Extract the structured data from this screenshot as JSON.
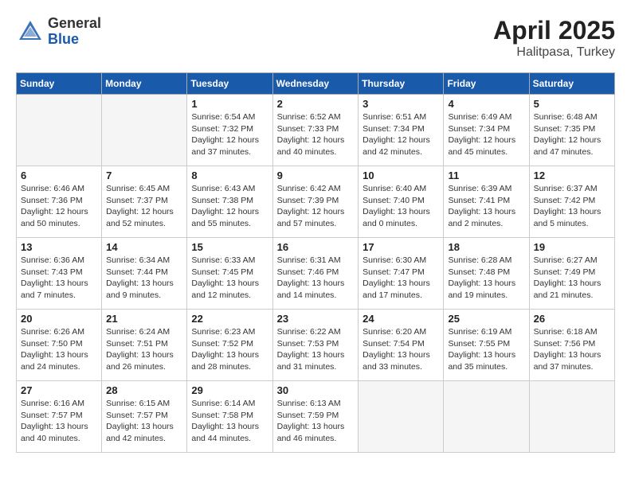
{
  "header": {
    "logo_general": "General",
    "logo_blue": "Blue",
    "month_year": "April 2025",
    "location": "Halitpasa, Turkey"
  },
  "weekdays": [
    "Sunday",
    "Monday",
    "Tuesday",
    "Wednesday",
    "Thursday",
    "Friday",
    "Saturday"
  ],
  "weeks": [
    [
      {
        "day": "",
        "info": ""
      },
      {
        "day": "",
        "info": ""
      },
      {
        "day": "1",
        "info": "Sunrise: 6:54 AM\nSunset: 7:32 PM\nDaylight: 12 hours and 37 minutes."
      },
      {
        "day": "2",
        "info": "Sunrise: 6:52 AM\nSunset: 7:33 PM\nDaylight: 12 hours and 40 minutes."
      },
      {
        "day": "3",
        "info": "Sunrise: 6:51 AM\nSunset: 7:34 PM\nDaylight: 12 hours and 42 minutes."
      },
      {
        "day": "4",
        "info": "Sunrise: 6:49 AM\nSunset: 7:34 PM\nDaylight: 12 hours and 45 minutes."
      },
      {
        "day": "5",
        "info": "Sunrise: 6:48 AM\nSunset: 7:35 PM\nDaylight: 12 hours and 47 minutes."
      }
    ],
    [
      {
        "day": "6",
        "info": "Sunrise: 6:46 AM\nSunset: 7:36 PM\nDaylight: 12 hours and 50 minutes."
      },
      {
        "day": "7",
        "info": "Sunrise: 6:45 AM\nSunset: 7:37 PM\nDaylight: 12 hours and 52 minutes."
      },
      {
        "day": "8",
        "info": "Sunrise: 6:43 AM\nSunset: 7:38 PM\nDaylight: 12 hours and 55 minutes."
      },
      {
        "day": "9",
        "info": "Sunrise: 6:42 AM\nSunset: 7:39 PM\nDaylight: 12 hours and 57 minutes."
      },
      {
        "day": "10",
        "info": "Sunrise: 6:40 AM\nSunset: 7:40 PM\nDaylight: 13 hours and 0 minutes."
      },
      {
        "day": "11",
        "info": "Sunrise: 6:39 AM\nSunset: 7:41 PM\nDaylight: 13 hours and 2 minutes."
      },
      {
        "day": "12",
        "info": "Sunrise: 6:37 AM\nSunset: 7:42 PM\nDaylight: 13 hours and 5 minutes."
      }
    ],
    [
      {
        "day": "13",
        "info": "Sunrise: 6:36 AM\nSunset: 7:43 PM\nDaylight: 13 hours and 7 minutes."
      },
      {
        "day": "14",
        "info": "Sunrise: 6:34 AM\nSunset: 7:44 PM\nDaylight: 13 hours and 9 minutes."
      },
      {
        "day": "15",
        "info": "Sunrise: 6:33 AM\nSunset: 7:45 PM\nDaylight: 13 hours and 12 minutes."
      },
      {
        "day": "16",
        "info": "Sunrise: 6:31 AM\nSunset: 7:46 PM\nDaylight: 13 hours and 14 minutes."
      },
      {
        "day": "17",
        "info": "Sunrise: 6:30 AM\nSunset: 7:47 PM\nDaylight: 13 hours and 17 minutes."
      },
      {
        "day": "18",
        "info": "Sunrise: 6:28 AM\nSunset: 7:48 PM\nDaylight: 13 hours and 19 minutes."
      },
      {
        "day": "19",
        "info": "Sunrise: 6:27 AM\nSunset: 7:49 PM\nDaylight: 13 hours and 21 minutes."
      }
    ],
    [
      {
        "day": "20",
        "info": "Sunrise: 6:26 AM\nSunset: 7:50 PM\nDaylight: 13 hours and 24 minutes."
      },
      {
        "day": "21",
        "info": "Sunrise: 6:24 AM\nSunset: 7:51 PM\nDaylight: 13 hours and 26 minutes."
      },
      {
        "day": "22",
        "info": "Sunrise: 6:23 AM\nSunset: 7:52 PM\nDaylight: 13 hours and 28 minutes."
      },
      {
        "day": "23",
        "info": "Sunrise: 6:22 AM\nSunset: 7:53 PM\nDaylight: 13 hours and 31 minutes."
      },
      {
        "day": "24",
        "info": "Sunrise: 6:20 AM\nSunset: 7:54 PM\nDaylight: 13 hours and 33 minutes."
      },
      {
        "day": "25",
        "info": "Sunrise: 6:19 AM\nSunset: 7:55 PM\nDaylight: 13 hours and 35 minutes."
      },
      {
        "day": "26",
        "info": "Sunrise: 6:18 AM\nSunset: 7:56 PM\nDaylight: 13 hours and 37 minutes."
      }
    ],
    [
      {
        "day": "27",
        "info": "Sunrise: 6:16 AM\nSunset: 7:57 PM\nDaylight: 13 hours and 40 minutes."
      },
      {
        "day": "28",
        "info": "Sunrise: 6:15 AM\nSunset: 7:57 PM\nDaylight: 13 hours and 42 minutes."
      },
      {
        "day": "29",
        "info": "Sunrise: 6:14 AM\nSunset: 7:58 PM\nDaylight: 13 hours and 44 minutes."
      },
      {
        "day": "30",
        "info": "Sunrise: 6:13 AM\nSunset: 7:59 PM\nDaylight: 13 hours and 46 minutes."
      },
      {
        "day": "",
        "info": ""
      },
      {
        "day": "",
        "info": ""
      },
      {
        "day": "",
        "info": ""
      }
    ]
  ]
}
